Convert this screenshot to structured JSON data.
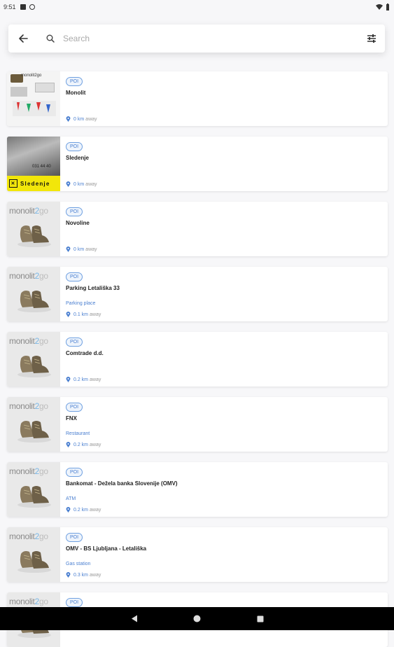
{
  "status_bar": {
    "time": "9:51",
    "left_icons": [
      "sim-card-icon",
      "data-saver-icon"
    ],
    "right_icons": [
      "wifi-icon",
      "battery-icon"
    ]
  },
  "search": {
    "placeholder": "Search",
    "value": "",
    "back_icon": "arrow-back-icon",
    "search_icon": "search-icon",
    "filter_icon": "filter-tune-icon"
  },
  "poi_badge_label": "POI",
  "distance_suffix": "away",
  "accent_color": "#4a7fd0",
  "results": [
    {
      "title": "Monolit",
      "category": "",
      "distance": "0 km",
      "thumbnail": "monolit"
    },
    {
      "title": "Sledenje",
      "category": "",
      "distance": "0 km",
      "thumbnail": "sledenje"
    },
    {
      "title": "Novoline",
      "category": "",
      "distance": "0 km",
      "thumbnail": "monolit2go"
    },
    {
      "title": "Parking Letališka 33",
      "category": "Parking place",
      "distance": "0.1 km",
      "thumbnail": "monolit2go"
    },
    {
      "title": "Comtrade d.d.",
      "category": "",
      "distance": "0.2 km",
      "thumbnail": "monolit2go"
    },
    {
      "title": "FNX",
      "category": "Restaurant",
      "distance": "0.2 km",
      "thumbnail": "monolit2go"
    },
    {
      "title": "Bankomat - Dežela banka Slovenije (OMV)",
      "category": "ATM",
      "distance": "0.2 km",
      "thumbnail": "monolit2go"
    },
    {
      "title": "OMV - BS Ljubljana - Letališka",
      "category": "Gas station",
      "distance": "0.3 km",
      "thumbnail": "monolit2go"
    },
    {
      "title": "",
      "category": "",
      "distance": "",
      "thumbnail": "monolit2go"
    }
  ],
  "thumbnail_text": {
    "monolit2go": {
      "part1": "monolit",
      "part2": "2",
      "part3": "go"
    },
    "monolit": {
      "caption": "monolit2go"
    },
    "sledenje": {
      "band": "Sledenje",
      "phone": "031 44 40"
    }
  },
  "nav_bar": {
    "back": "nav-back-icon",
    "home": "nav-home-icon",
    "recents": "nav-recents-icon"
  }
}
